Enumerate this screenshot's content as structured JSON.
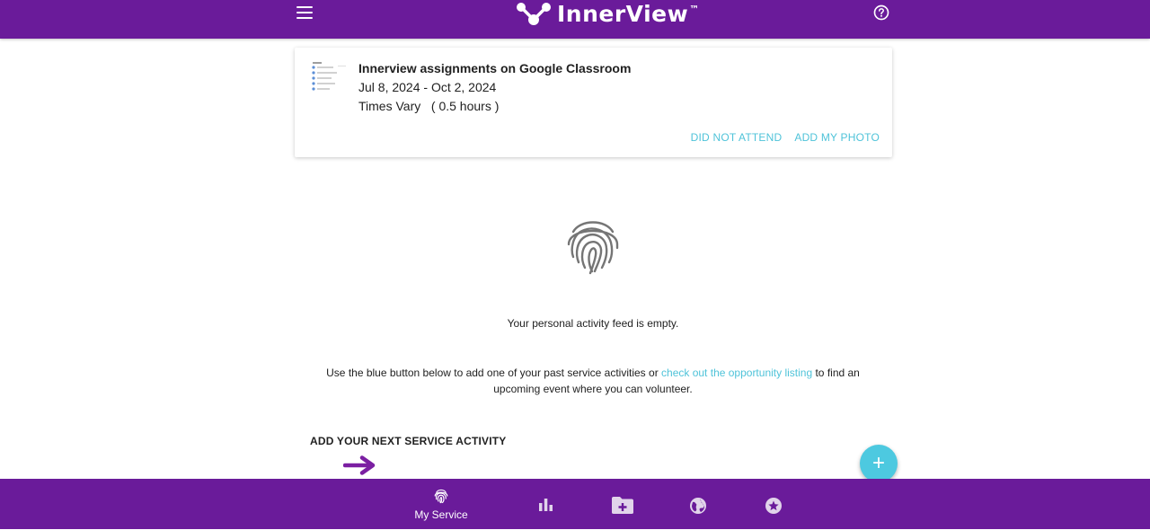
{
  "header": {
    "brand": "InnerView",
    "trademark": "™",
    "menu_icon": "hamburger-menu-icon",
    "help_icon": "help-circle-icon"
  },
  "event_card": {
    "title": "Innerview assignments on Google Classroom",
    "date_range": "Jul 8, 2024 - Oct 2, 2024",
    "times": "Times Vary   ( 0.5 hours )",
    "actions": {
      "did_not_attend": "DID NOT ATTEND",
      "add_photo": "ADD MY PHOTO"
    }
  },
  "feed": {
    "empty_message": "Your personal activity feed is empty.",
    "help_before_link": "Use the blue button below to add one of your past service activities or ",
    "help_link": "check out the opportunity listing",
    "help_after_link": " to find an upcoming event where you can volunteer.",
    "add_label": "ADD YOUR NEXT SERVICE ACTIVITY",
    "fab_symbol": "+"
  },
  "bottom_nav": {
    "my_service": "My Service",
    "icons": [
      "fingerprint-icon",
      "bar-chart-icon",
      "folder-add-icon",
      "globe-icon",
      "star-circle-icon"
    ]
  },
  "colors": {
    "brand_purple": "#6a1b9a",
    "accent_cyan": "#4fc3d9",
    "fab": "#4dc9e0",
    "arrow_purple": "#7b1fa2"
  }
}
